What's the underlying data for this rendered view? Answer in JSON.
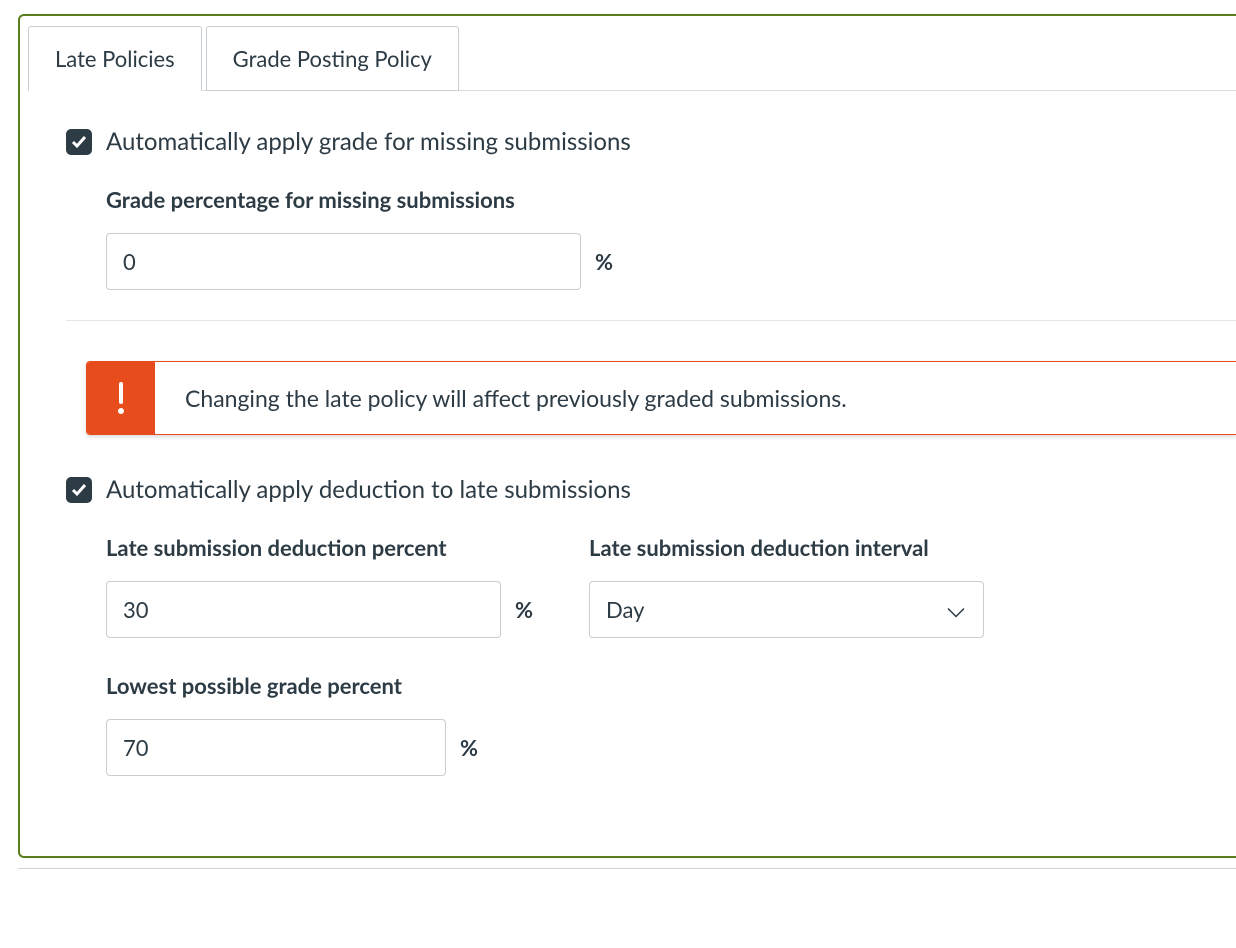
{
  "tabs": {
    "late_policies": "Late Policies",
    "grade_posting_policy": "Grade Posting Policy"
  },
  "missing": {
    "checkbox_label": "Automatically apply grade for missing submissions",
    "field_label": "Grade percentage for missing submissions",
    "value": "0",
    "suffix": "%"
  },
  "alert": {
    "text": "Changing the late policy will affect previously graded submissions."
  },
  "late": {
    "checkbox_label": "Automatically apply deduction to late submissions",
    "deduction_percent_label": "Late submission deduction percent",
    "deduction_percent_value": "30",
    "deduction_percent_suffix": "%",
    "interval_label": "Late submission deduction interval",
    "interval_value": "Day",
    "lowest_label": "Lowest possible grade percent",
    "lowest_value": "70",
    "lowest_suffix": "%"
  }
}
